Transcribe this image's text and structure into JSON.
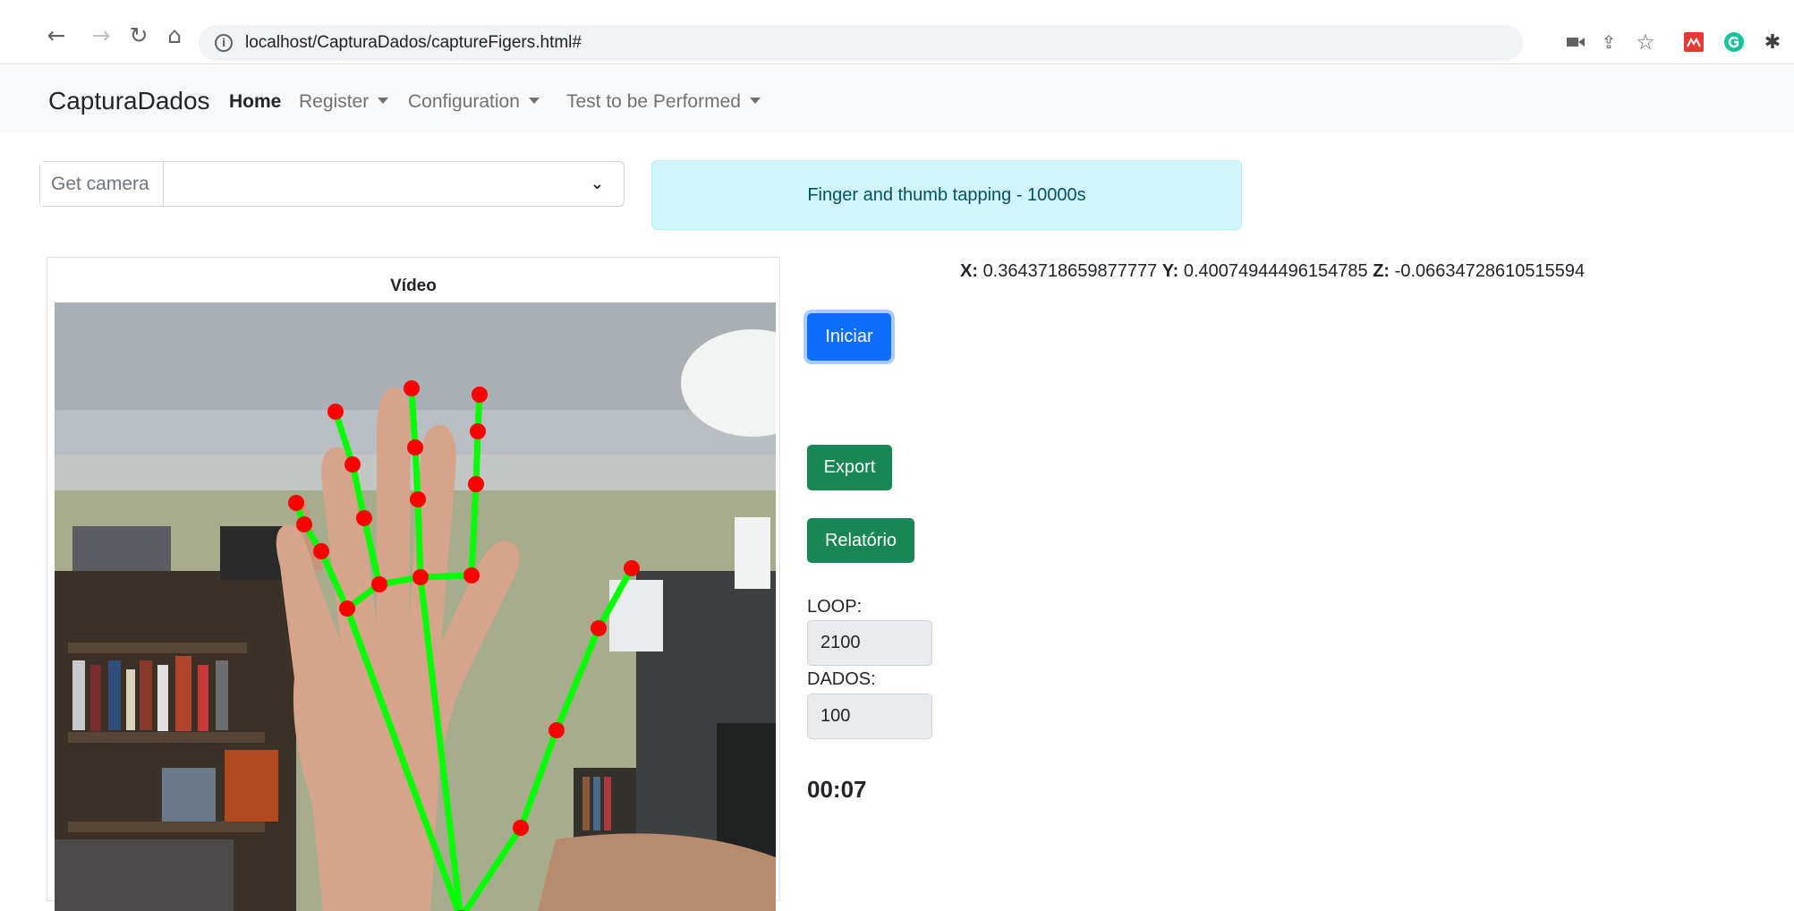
{
  "browser": {
    "url": "localhost/CapturaDados/captureFigers.html#",
    "icons": {
      "back": "arrow-left-icon",
      "forward": "arrow-right-icon",
      "reload": "reload-icon",
      "home": "home-icon",
      "info": "info-icon",
      "camera": "camera-icon",
      "share": "share-icon",
      "bookmark": "star-icon",
      "ext1": "extension-icon",
      "ext2": "grammarly-icon",
      "puzzle": "puzzle-icon"
    }
  },
  "navbar": {
    "brand": "CapturaDados",
    "links": [
      {
        "label": "Home",
        "active": true
      },
      {
        "label": "Register"
      },
      {
        "label": "Configuration"
      },
      {
        "label": "Test to be Performed"
      }
    ]
  },
  "camera": {
    "label": "Get camera",
    "selected": ""
  },
  "test_alert": "Finger and thumb tapping - 10000s",
  "video": {
    "title": "Vídeo"
  },
  "coords": {
    "x_label": "X:",
    "x_value": "0.3643718659877777",
    "y_label": "Y:",
    "y_value": "0.40074944496154785",
    "z_label": "Z:",
    "z_value": "-0.06634728610515594"
  },
  "buttons": {
    "start": "Iniciar",
    "export": "Export",
    "report": "Relatório"
  },
  "fields": {
    "loop_label": "LOOP:",
    "loop_value": "2100",
    "dados_label": "DADOS:",
    "dados_value": "100"
  },
  "timer": "00:07",
  "colors": {
    "primary": "#0d6efd",
    "success": "#198754",
    "info_bg": "#cff4fc",
    "landmark": "#ff0000",
    "connection": "#00ff00"
  }
}
